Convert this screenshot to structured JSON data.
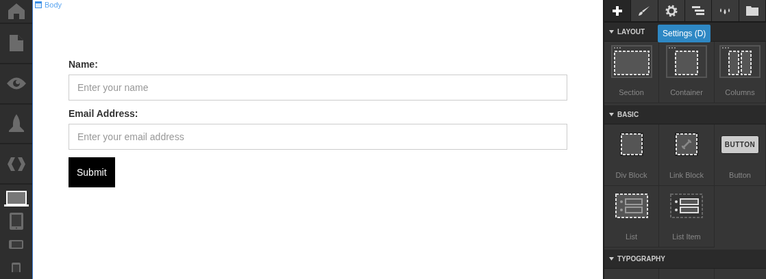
{
  "sidebar": {
    "nav": [
      {
        "kind": "home"
      },
      {
        "kind": "page"
      },
      {
        "kind": "eye"
      },
      {
        "kind": "rocket"
      },
      {
        "kind": "code"
      }
    ],
    "devices": [
      {
        "kind": "laptop",
        "selected": true
      },
      {
        "kind": "tablet",
        "selected": false
      },
      {
        "kind": "phone-landscape",
        "selected": false
      },
      {
        "kind": "phone",
        "selected": false
      }
    ]
  },
  "canvas": {
    "breadcrumb": "Body",
    "form": {
      "fields": [
        {
          "label": "Name:",
          "placeholder": "Enter your name"
        },
        {
          "label": "Email Address:",
          "placeholder": "Enter your email address"
        }
      ],
      "submit": "Submit"
    }
  },
  "panel": {
    "tabs": [
      {
        "kind": "add",
        "selected": true
      },
      {
        "kind": "brush",
        "selected": false
      },
      {
        "kind": "settings",
        "selected": false
      },
      {
        "kind": "navigator",
        "selected": false
      },
      {
        "kind": "drops",
        "selected": false
      },
      {
        "kind": "folder",
        "selected": false
      }
    ],
    "tooltip": "Settings (D)",
    "sections": [
      {
        "title": "LAYOUT",
        "expanded": true,
        "items": [
          {
            "label": "Section",
            "kind": "section"
          },
          {
            "label": "Container",
            "kind": "container"
          },
          {
            "label": "Columns",
            "kind": "columns"
          }
        ]
      },
      {
        "title": "BASIC",
        "expanded": true,
        "items": [
          {
            "label": "Div Block",
            "kind": "div"
          },
          {
            "label": "Link Block",
            "kind": "link"
          },
          {
            "label": "Button",
            "kind": "button",
            "preview": "BUTTON"
          },
          {
            "label": "List",
            "kind": "list"
          },
          {
            "label": "List Item",
            "kind": "list-item"
          }
        ]
      },
      {
        "title": "TYPOGRAPHY",
        "expanded": true
      }
    ]
  }
}
